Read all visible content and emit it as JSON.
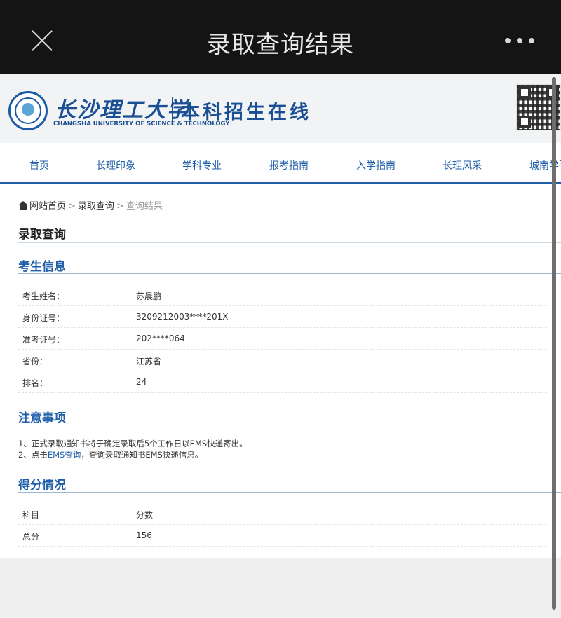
{
  "appbar": {
    "title": "录取查询结果",
    "close_icon": "close-icon",
    "more_icon": "more-dots-icon"
  },
  "header": {
    "university_cn": "长沙理工大学",
    "university_en": "CHANGSHA UNIVERSITY OF SCIENCE & TECHNOLOGY",
    "site_name": "本科招生在线"
  },
  "nav": {
    "items": [
      "首页",
      "长理印象",
      "学科专业",
      "报考指南",
      "入学指南",
      "长理风采",
      "城南学院"
    ]
  },
  "breadcrumb": {
    "home": "网站首页",
    "sep": ">",
    "level2": "录取查询",
    "current": "查询结果"
  },
  "page_title": "录取查询",
  "candidate": {
    "heading": "考生信息",
    "rows": [
      {
        "label": "考生姓名：",
        "value": "苏晨鹏"
      },
      {
        "label": "身份证号：",
        "value": "3209212003****201X"
      },
      {
        "label": "准考证号：",
        "value": "202****064"
      },
      {
        "label": "省份：",
        "value": "江苏省"
      },
      {
        "label": "排名：",
        "value": "24"
      }
    ]
  },
  "notes": {
    "heading": "注意事项",
    "line1": "1、正式录取通知书将于确定录取后5个工作日以EMS快递寄出。",
    "line2_prefix": "2、点击",
    "line2_link": "EMS查询",
    "line2_suffix": "，查询录取通知书EMS快递信息。"
  },
  "scores": {
    "heading": "得分情况",
    "header": {
      "subject": "科目",
      "score": "分数"
    },
    "rows": [
      {
        "subject": "总分",
        "score": "156"
      }
    ]
  },
  "colors": {
    "brand_blue": "#1f5fa8",
    "appbar_bg": "#141414"
  }
}
